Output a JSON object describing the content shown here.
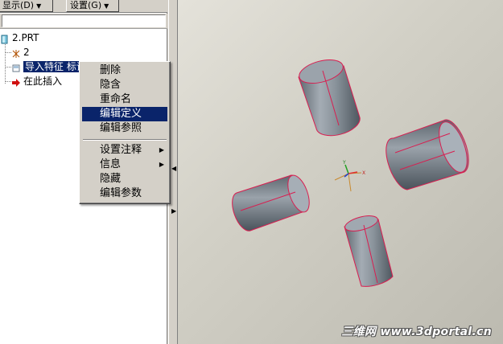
{
  "toolbar": {
    "show_label": "显示(D)",
    "settings_label": "设置(G)"
  },
  "tree": {
    "root_label": "2.PRT",
    "csys_label": "2",
    "import_label": "导入特征 标识",
    "insert_label": "在此插入"
  },
  "context_menu": {
    "items": [
      "删除",
      "隐含",
      "重命名",
      "编辑定义",
      "编辑参照"
    ],
    "items2": [
      "设置注释",
      "信息",
      "隐藏",
      "编辑参数"
    ],
    "active_index": 3
  },
  "watermark": "三维网 www.3dportal.cn",
  "colors": {
    "selection": "#0a246a",
    "edge": "#d81e50",
    "cylinder": "#8b939b"
  },
  "icons": [
    "model-icon",
    "csys-icon",
    "import-feature-icon",
    "insert-arrow-icon",
    "submenu-arrow-icon",
    "dropdown-icon"
  ]
}
